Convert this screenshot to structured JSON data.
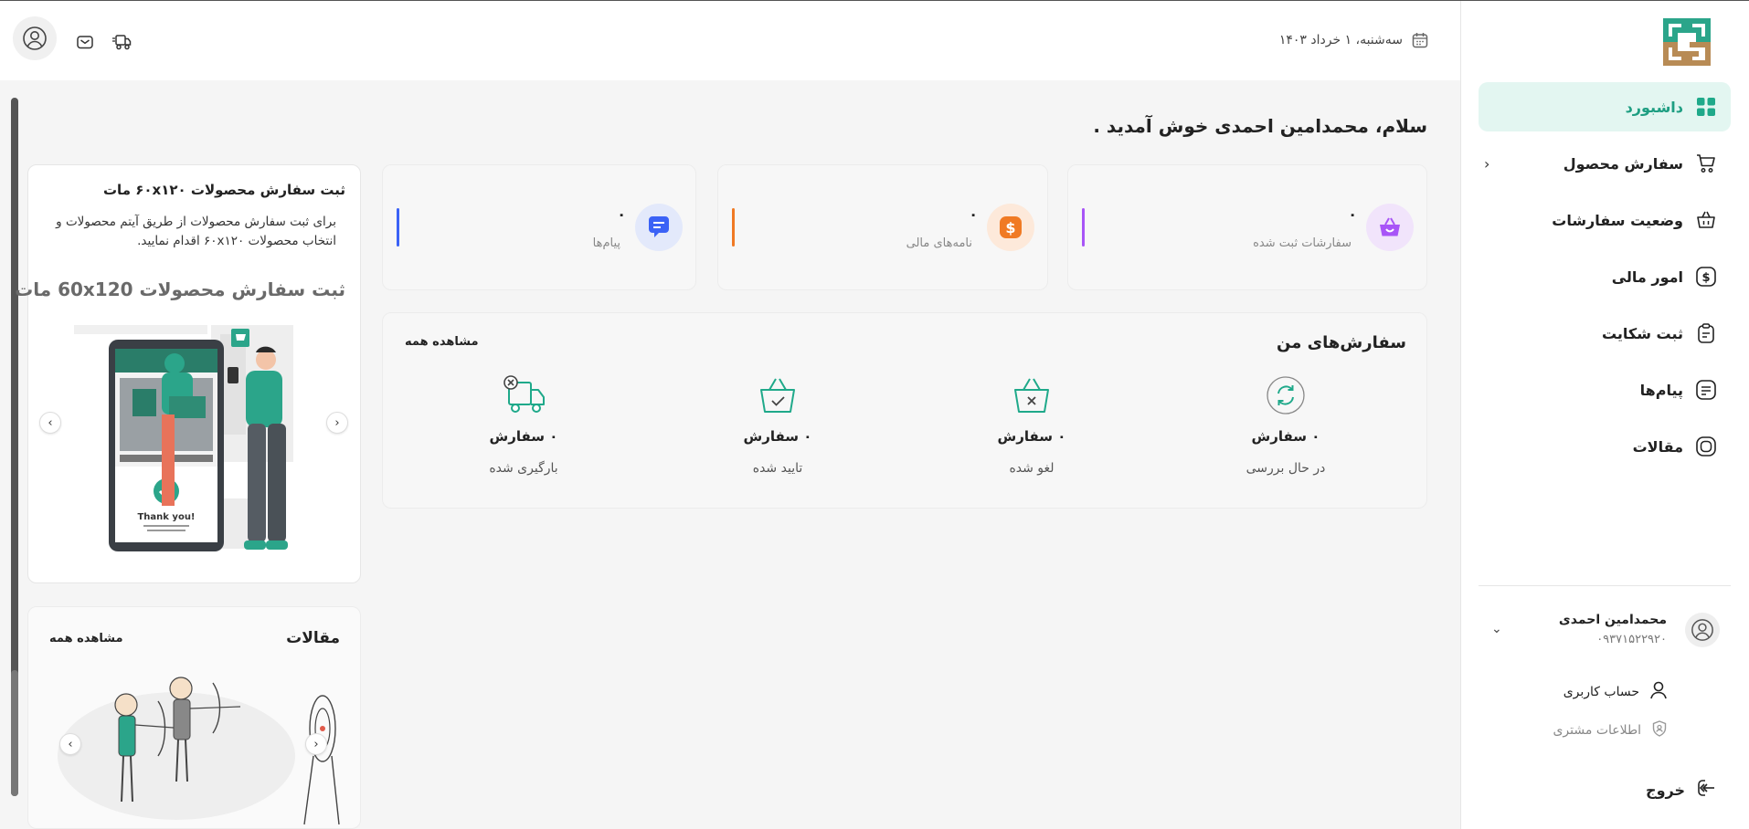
{
  "sidebar": {
    "items": [
      {
        "label": "داشبورد",
        "icon": "dashboard-grid-icon"
      },
      {
        "label": "سفارش محصول",
        "icon": "cart-icon"
      },
      {
        "label": "وضعیت سفارشات",
        "icon": "basket-icon"
      },
      {
        "label": "امور مالی",
        "icon": "dollar-icon"
      },
      {
        "label": "ثبت شکایت",
        "icon": "clipboard-icon"
      },
      {
        "label": "پیام‌ها",
        "icon": "message-icon"
      },
      {
        "label": "مقالات",
        "icon": "article-icon"
      }
    ],
    "user": {
      "name": "محمدامین احمدی",
      "phone": "۰۹۳۷۱۵۲۲۹۲۰"
    },
    "account": "حساب کاربری",
    "customer_info": "اطلاعات مشتری",
    "logout": "خروج"
  },
  "header": {
    "date": "سه‌شنبه، ۱ خرداد ۱۴۰۳"
  },
  "main": {
    "greeting": "سلام، محمدامین احمدی خوش آمدید .",
    "stats": [
      {
        "value": "۰",
        "label": "سفارشات ثبت شده",
        "color": "#a855f7"
      },
      {
        "value": "۰",
        "label": "نامه‌های مالی",
        "color": "#f07a24"
      },
      {
        "value": "۰",
        "label": "پیام‌ها",
        "color": "#3b62f6"
      }
    ],
    "orders": {
      "title": "سفارش‌های من",
      "see_all": "مشاهده همه",
      "items": [
        {
          "count": "۰ سفارش",
          "label": "در حال بررسی",
          "icon": "refresh-icon"
        },
        {
          "count": "۰ سفارش",
          "label": "لغو شده",
          "icon": "basket-cancel-icon"
        },
        {
          "count": "۰ سفارش",
          "label": "تایید شده",
          "icon": "basket-check-icon"
        },
        {
          "count": "۰ سفارش",
          "label": "بارگیری شده",
          "icon": "truck-icon"
        }
      ]
    },
    "promo": {
      "title": "ثبت سفارش محصولات ۶۰x۱۲۰ مات",
      "description": "برای ثبت سفارش محصولات از طریق آیتم محصولات و انتخاب محصولات ۶۰x۱۲۰ اقدام نمایید.",
      "banner": "ثبت سفارش محصولات 60x120 مات",
      "phone_text": "Thank you!"
    },
    "articles": {
      "title": "مقالات",
      "see_all": "مشاهده همه"
    }
  },
  "colors": {
    "accent": "#1fa98a",
    "active_bg": "#e3f6f1"
  }
}
